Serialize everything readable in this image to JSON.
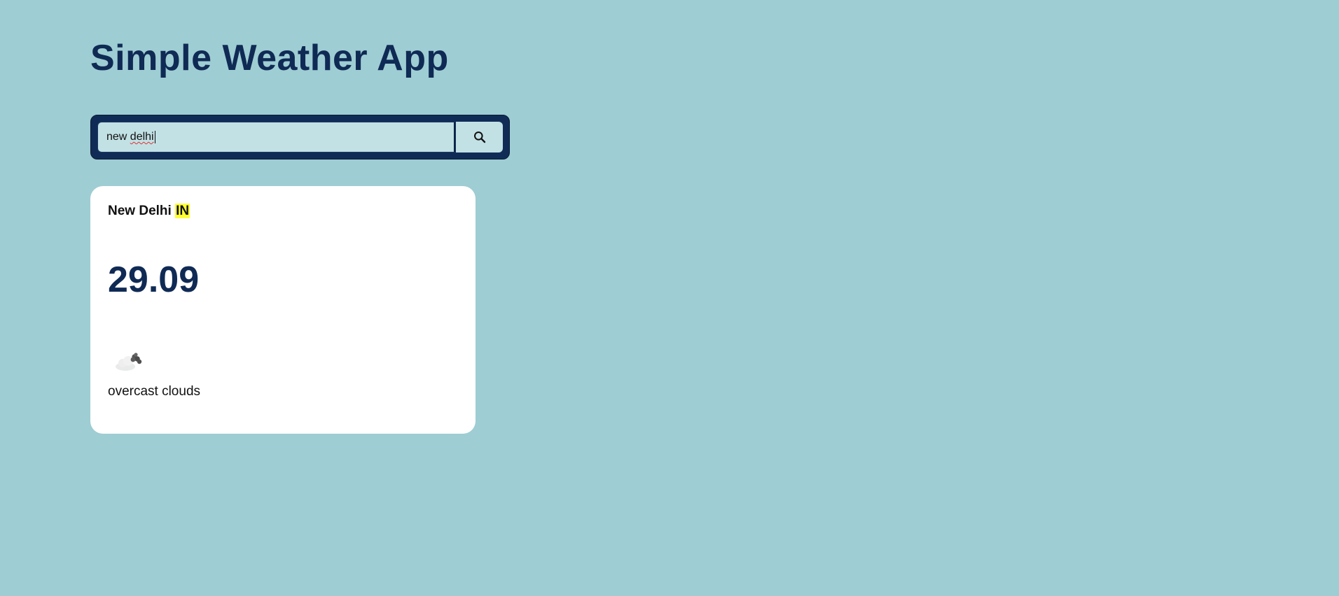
{
  "app": {
    "title": "Simple Weather App"
  },
  "search": {
    "value_word1": "new ",
    "value_word2": "delhi",
    "button_icon": "search-icon"
  },
  "weather": {
    "city": "New Delhi",
    "country": "IN",
    "temperature": "29.09",
    "description": "overcast clouds",
    "icon": "overcast-clouds-icon"
  },
  "colors": {
    "background": "#9ecdd3",
    "title": "#0f2a54",
    "search_frame": "#102c56",
    "search_field": "#c2e1e5",
    "card": "#ffffff",
    "country_highlight": "#ffff33"
  }
}
